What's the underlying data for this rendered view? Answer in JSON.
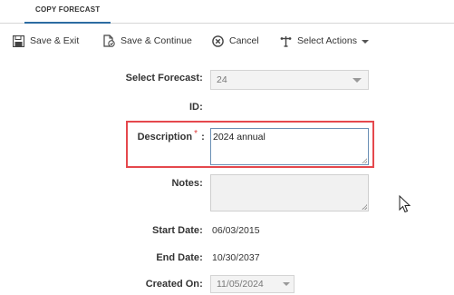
{
  "tab": {
    "label": "COPY FORECAST"
  },
  "toolbar": {
    "save_exit": "Save & Exit",
    "save_continue": "Save & Continue",
    "cancel": "Cancel",
    "select_actions": "Select Actions"
  },
  "form": {
    "select_forecast": {
      "label": "Select Forecast",
      "value": "24"
    },
    "id": {
      "label": "ID",
      "value": ""
    },
    "description": {
      "label": "Description",
      "required_mark": "*",
      "value": "2024 annual"
    },
    "notes": {
      "label": "Notes",
      "value": ""
    },
    "start_date": {
      "label": "Start Date",
      "value": "06/03/2015"
    },
    "end_date": {
      "label": "End Date",
      "value": "10/30/2037"
    },
    "created_on": {
      "label": "Created On",
      "value": "11/05/2024"
    }
  },
  "separator": ":",
  "colors": {
    "accent": "#2d6ca2",
    "highlight": "#e5484d",
    "required": "#e03a3a"
  }
}
